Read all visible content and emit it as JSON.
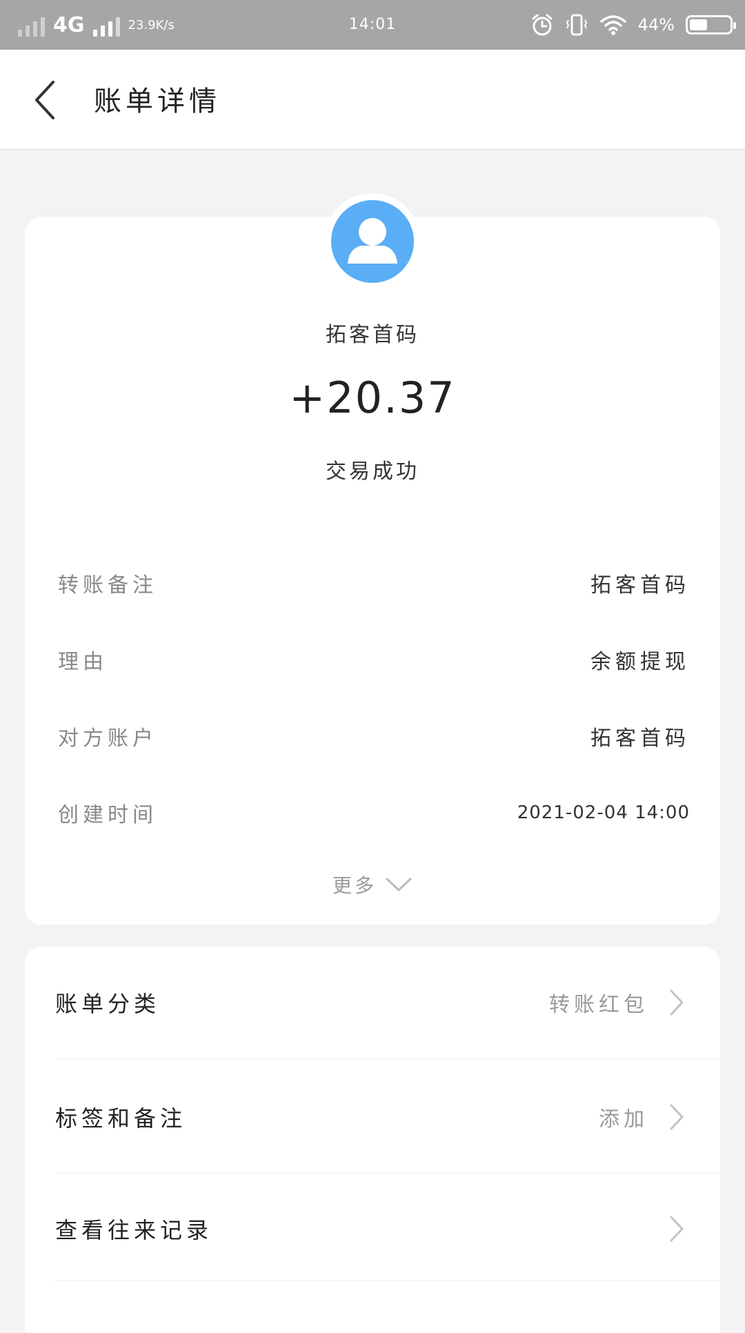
{
  "status_bar": {
    "network": "4G",
    "speed": "23.9K/s",
    "time": "14:01",
    "battery": "44%",
    "battery_level": 0.44,
    "icons": [
      "alarm-icon",
      "vibrate-icon",
      "wifi-icon",
      "battery-icon"
    ]
  },
  "header": {
    "title": "账单详情"
  },
  "bill": {
    "payee": "拓客首码",
    "amount": "+20.37",
    "status": "交易成功",
    "details": [
      {
        "label": "转账备注",
        "value": "拓客首码"
      },
      {
        "label": "理由",
        "value": "余额提现"
      },
      {
        "label": "对方账户",
        "value": "拓客首码"
      },
      {
        "label": "创建时间",
        "value": "2021-02-04 14:00"
      }
    ],
    "more_label": "更多"
  },
  "options": [
    {
      "label": "账单分类",
      "value": "转账红包"
    },
    {
      "label": "标签和备注",
      "value": "添加"
    },
    {
      "label": "查看往来记录",
      "value": ""
    }
  ],
  "colors": {
    "avatar_bg": "#5aaef5",
    "status_bar_bg": "#a6a6a6",
    "page_bg": "#f3f3f3"
  }
}
